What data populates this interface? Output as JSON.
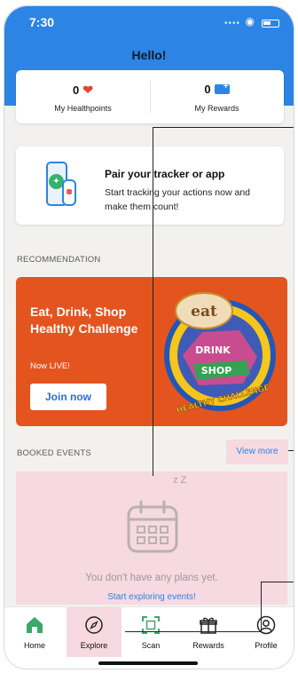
{
  "status_bar": {
    "time": "7:30"
  },
  "header": {
    "greeting": "Hello!"
  },
  "points": [
    {
      "value": "0",
      "label": "My Healthpoints",
      "icon": "heart-icon"
    },
    {
      "value": "0",
      "label": "My Rewards",
      "icon": "rewards-card-icon"
    }
  ],
  "pair_card": {
    "title": "Pair your tracker or app",
    "subtitle": "Start tracking your actions now and make them count!"
  },
  "recommendation": {
    "section_label": "RECOMMENDATION",
    "title": "Eat, Drink, Shop Healthy Challenge",
    "status": "Now LIVE!",
    "button": "Join now",
    "badge_text": {
      "top": "eat",
      "middle": "DRINK",
      "shop": "SHOP",
      "bottom": "HEALTHY CHALLENGE"
    }
  },
  "booked_events": {
    "section_label": "BOOKED EVENTS",
    "view_more": "View more",
    "empty_message": "You don't have any plans yet.",
    "empty_link": "Start exploring events!"
  },
  "tabs": [
    {
      "label": "Home",
      "icon": "home-icon"
    },
    {
      "label": "Explore",
      "icon": "compass-icon"
    },
    {
      "label": "Scan",
      "icon": "scan-icon"
    },
    {
      "label": "Rewards",
      "icon": "gift-icon"
    },
    {
      "label": "Profile",
      "icon": "profile-icon"
    }
  ],
  "colors": {
    "primary": "#2c85e5",
    "challenge": "#e4541f",
    "highlight": "#f7d9e1",
    "heart": "#e5452a"
  }
}
